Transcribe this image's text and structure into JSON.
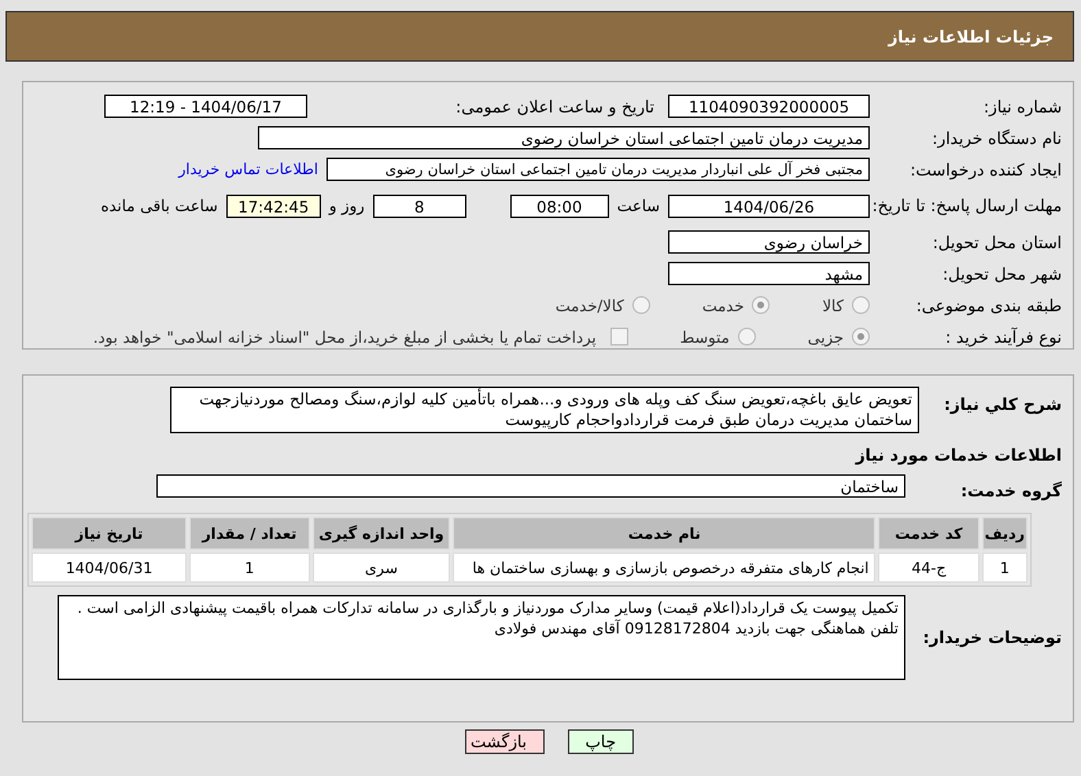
{
  "header": {
    "title": "جزئیات اطلاعات نیاز"
  },
  "need_number": {
    "label": "شماره نیاز:",
    "value": "1104090392000005"
  },
  "announce_datetime": {
    "label": "تاریخ و ساعت اعلان عمومی:",
    "value": "1404/06/17 - 12:19"
  },
  "buyer_org": {
    "label": "نام دستگاه خریدار:",
    "value": "مدیریت درمان تامین اجتماعی استان خراسان رضوی"
  },
  "requester": {
    "label": "ایجاد کننده درخواست:",
    "value": "مجتبی فخر آل علی انباردار مدیریت درمان تامین اجتماعی استان خراسان رضوی",
    "link": "اطلاعات تماس خریدار"
  },
  "deadline": {
    "label": "مهلت ارسال پاسخ: تا تاریخ:",
    "date": "1404/06/26",
    "time_label": "ساعت",
    "time": "08:00",
    "days": "8",
    "days_label": "روز و",
    "remaining": "17:42:45",
    "remaining_label": "ساعت باقی مانده"
  },
  "delivery_province": {
    "label": "استان محل تحویل:",
    "value": "خراسان رضوی"
  },
  "delivery_city": {
    "label": "شهر محل تحویل:",
    "value": "مشهد"
  },
  "classification": {
    "label": "طبقه بندی موضوعی:",
    "options": [
      {
        "label": "کالا",
        "selected": false
      },
      {
        "label": "خدمت",
        "selected": true
      },
      {
        "label": "کالا/خدمت",
        "selected": false
      }
    ]
  },
  "purchase_process": {
    "label": "نوع فرآیند خرید :",
    "options": [
      {
        "label": "جزیی",
        "selected": true
      },
      {
        "label": "متوسط",
        "selected": false
      }
    ],
    "payment_checkbox": {
      "label": "پرداخت تمام یا بخشی از مبلغ خرید،از محل \"اسناد خزانه اسلامی\" خواهد بود.",
      "checked": false
    }
  },
  "description": {
    "label": "شرح کلي نياز:",
    "value": "تعویض عایق باغچه،تعویض سنگ کف وپله های ورودی و...همراه باتأمین کلیه لوازم،سنگ ومصالح موردنیازجهت ساختمان مدیریت درمان طبق فرمت قراردادواحجام کارپیوست"
  },
  "services_heading": "اطلاعات خدمات مورد نیاز",
  "service_group": {
    "label": "گروه خدمت:",
    "value": "ساختمان"
  },
  "table": {
    "columns": [
      "ردیف",
      "کد خدمت",
      "نام خدمت",
      "واحد اندازه گیری",
      "تعداد / مقدار",
      "تاریخ نیاز"
    ],
    "rows": [
      [
        "1",
        "ج-44",
        "انجام کارهای متفرقه درخصوص بازسازی و بهسازی ساختمان ها",
        "سری",
        "1",
        "1404/06/31"
      ]
    ]
  },
  "buyer_notes": {
    "label": "توضیحات خریدار:",
    "value": "تکمیل پیوست یک قرارداد(اعلام قیمت) وسایر مدارک موردنیاز و بارگذاری در سامانه تدارکات همراه باقیمت پیشنهادی الزامی است .\nتلفن هماهنگی جهت بازدید 09128172804 آقای مهندس فولادی"
  },
  "buttons": [
    {
      "label": "چاپ",
      "kind": "print"
    },
    {
      "label": "بازگشت",
      "kind": "back"
    }
  ]
}
